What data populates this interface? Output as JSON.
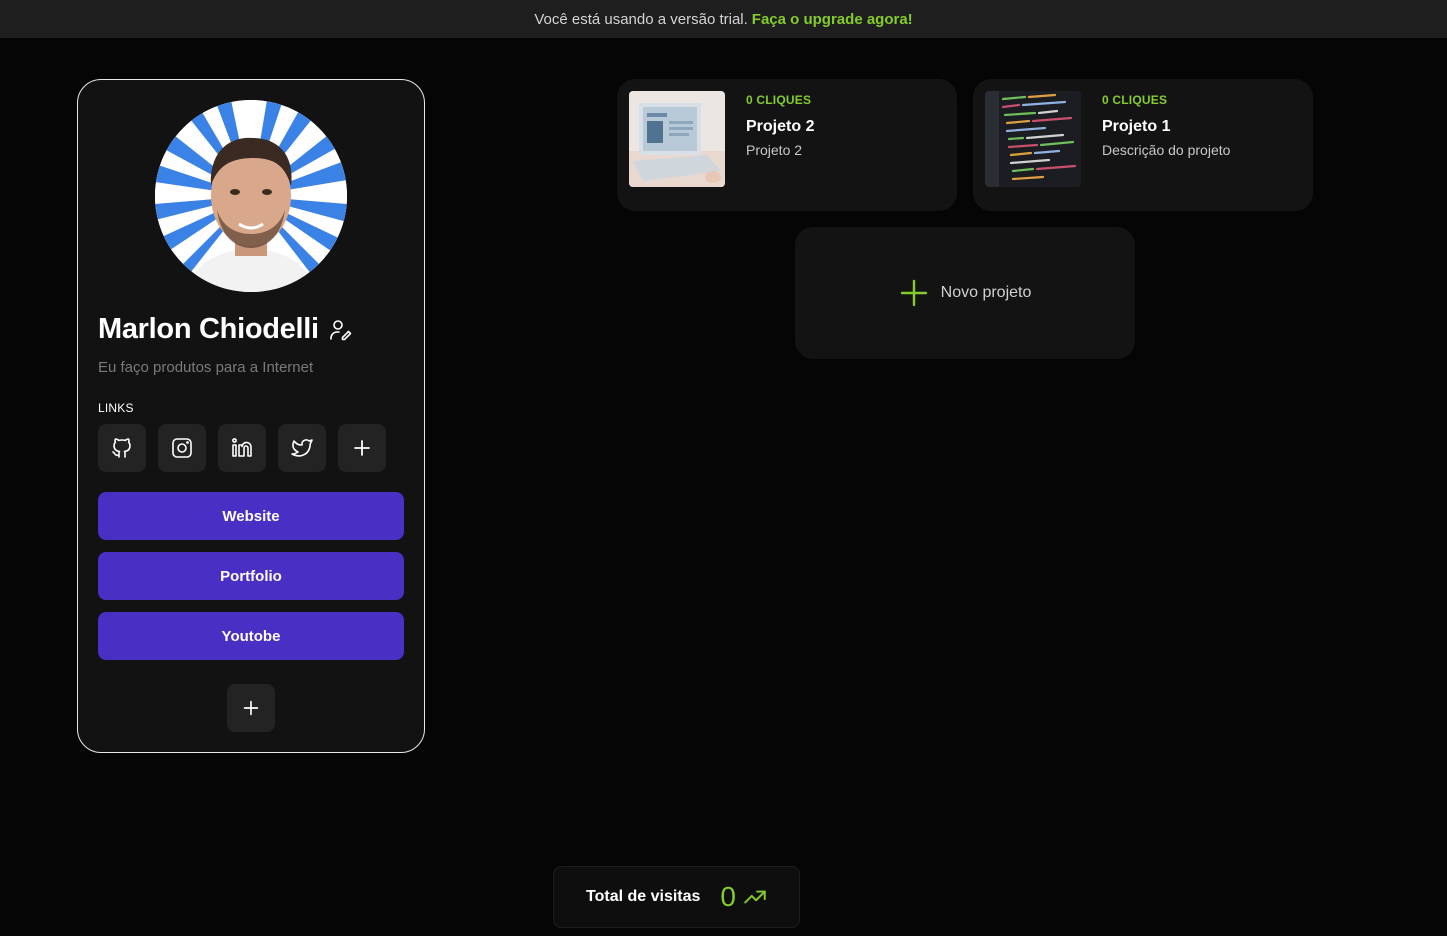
{
  "trial_bar": {
    "message": "Você está usando a versão trial.",
    "upgrade_link": "Faça o upgrade agora!"
  },
  "profile": {
    "name": "Marlon Chiodelli",
    "bio": "Eu faço produtos para a Internet",
    "links_label": "LINKS",
    "social_icons": [
      "github-icon",
      "instagram-icon",
      "linkedin-icon",
      "twitter-icon",
      "plus-icon"
    ],
    "link_buttons": [
      {
        "label": "Website"
      },
      {
        "label": "Portfolio"
      },
      {
        "label": "Youtobe"
      }
    ]
  },
  "projects": [
    {
      "clicks": "0 CLIQUES",
      "title": "Projeto 2",
      "description": "Projeto 2"
    },
    {
      "clicks": "0 CLIQUES",
      "title": "Projeto 1",
      "description": "Descrição do projeto"
    }
  ],
  "new_project": {
    "label": "Novo projeto"
  },
  "visits": {
    "label": "Total de visitas",
    "count": "0"
  },
  "colors": {
    "accent_green": "#84cc2c",
    "button_purple": "#4a2fc4",
    "background": "#050505",
    "card": "#131313"
  }
}
